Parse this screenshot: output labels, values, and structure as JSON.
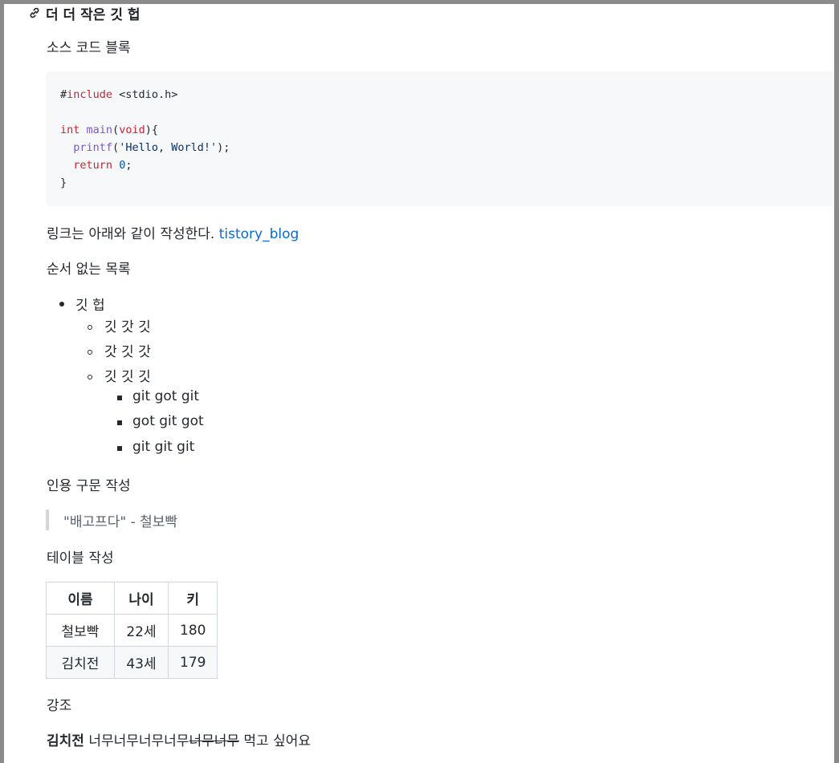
{
  "heading": {
    "text": "더 더 작은 깃 헙"
  },
  "sections": {
    "code_title": "소스 코드 블록",
    "link_line": "링크는 아래와 같이 작성한다.",
    "link_text": "tistory_blog",
    "list_title": "순서 없는 목록",
    "quote_title": "인용 구문 작성",
    "table_title": "테이블 작성",
    "emphasis_title": "강조"
  },
  "code": {
    "line1_hash": "#",
    "line1_kw": "include",
    "line1_rest": " <stdio.h>",
    "line3_kw1": "int",
    "line3_fn": "main",
    "line3_open": "(",
    "line3_kw2": "void",
    "line3_close": "){",
    "line4_fn": "printf",
    "line4_open": "(",
    "line4_str": "'Hello, World!'",
    "line4_close": ");",
    "line5_kw": "return",
    "line5_num": "0",
    "line5_end": ";",
    "line6": "}"
  },
  "list": {
    "level1": "깃 헙",
    "level2": [
      "깃 갓 깃",
      "갓 깃 갓",
      "깃 깃 깃"
    ],
    "level3": [
      "git got git",
      "got git got",
      "git git git"
    ]
  },
  "quote": {
    "text": "\"배고프다\" - 철보빡"
  },
  "table": {
    "headers": [
      "이름",
      "나이",
      "키"
    ],
    "rows": [
      [
        "철보빡",
        "22세",
        "180"
      ],
      [
        "김치전",
        "43세",
        "179"
      ]
    ]
  },
  "emphasis": {
    "bold": "김치전",
    "plain": " 너무너무너무너무",
    "strike": "너무너무",
    "tail": " 먹고 싶어요"
  }
}
